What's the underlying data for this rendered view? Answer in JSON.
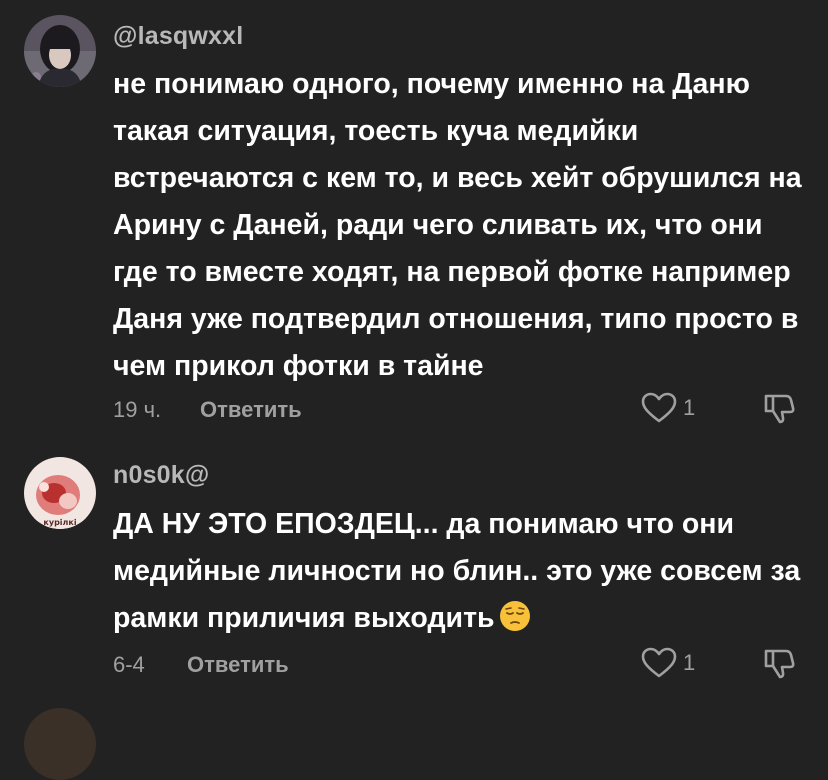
{
  "colors": {
    "background": "#222222",
    "primary_text": "#ffffff",
    "secondary_text": "#a0a0a0",
    "username_text": "#b8b8b8"
  },
  "comments": [
    {
      "username": "@lasqwxxl",
      "text": "не понимаю одного, почему именно на Даню такая ситуация, тоесть куча медийки встречаются с кем то, и весь хейт обрушился на Арину с Даней, ради чего сливать их, что они где то вместе ходят, на первой фотке например Даня уже подтвердил отношения, типо просто в чем прикол фотки в тайне",
      "time": "19 ч.",
      "reply_label": "Ответить",
      "likes": "1",
      "avatar_icon": "user-avatar-dark-hair",
      "like_icon": "heart-outline-icon",
      "dislike_icon": "thumbs-down-icon"
    },
    {
      "username": "n0s0k@",
      "text": "ДА НУ ЭТО ЕПОЗДЕЦ... да понимаю что они медийные личности но блин.. это уже совсем за рамки приличия выходить",
      "emoji": "pensive-face-emoji",
      "time": "6-4",
      "reply_label": "Ответить",
      "likes": "1",
      "avatar_icon": "user-avatar-pink-red",
      "avatar_caption": "курілкі",
      "like_icon": "heart-outline-icon",
      "dislike_icon": "thumbs-down-icon"
    }
  ]
}
